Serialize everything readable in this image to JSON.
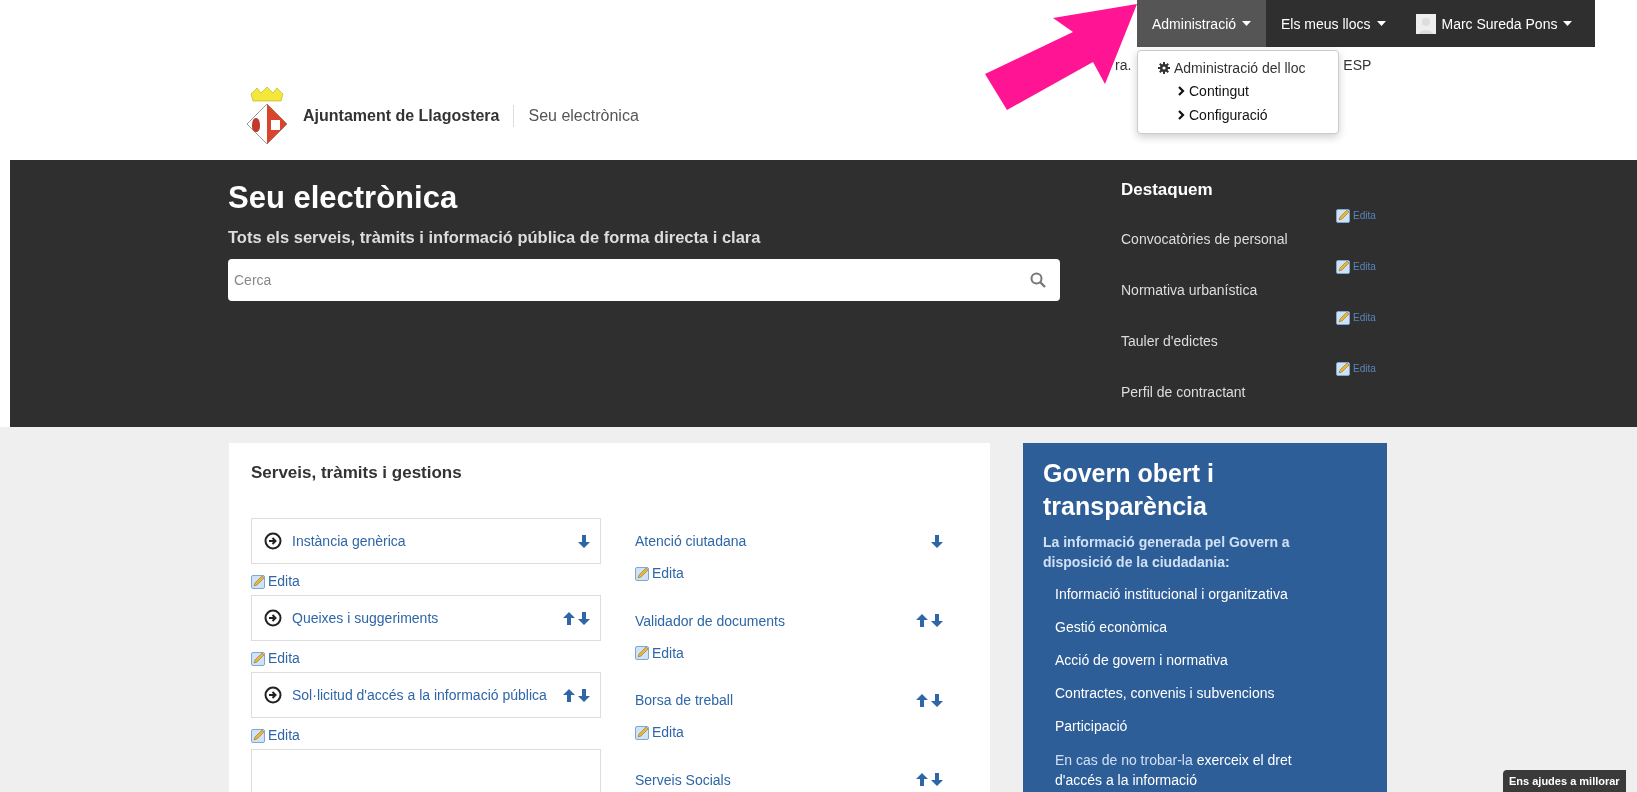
{
  "admin_bar": {
    "menus": [
      {
        "label": "Administració",
        "selected": true,
        "kind": "menu"
      },
      {
        "label": "Els meus llocs",
        "selected": false,
        "kind": "menu"
      },
      {
        "label": "Marc Sureda Pons",
        "selected": false,
        "kind": "user"
      }
    ]
  },
  "dropdown": {
    "title": "Administració del lloc",
    "items": [
      "Contingut",
      "Configuració"
    ]
  },
  "language_links": [
    "ra.",
    "ESP"
  ],
  "header": {
    "site_name": "Ajuntament de Llagostera",
    "section": "Seu electrònica"
  },
  "hero": {
    "title": "Seu electrònica",
    "subtitle": "Tots els serveis, tràmits i informació pública de forma directa i clara",
    "search": {
      "placeholder": "Cerca"
    }
  },
  "featured": {
    "title": "Destaquem",
    "items": [
      {
        "edit": "Edita",
        "label": "Convocatòries de personal"
      },
      {
        "edit": "Edita",
        "label": "Normativa urbanística"
      },
      {
        "edit": "Edita",
        "label": "Tauler d'edictes"
      },
      {
        "edit": "Edita",
        "label": "Perfil de contractant"
      }
    ]
  },
  "services": {
    "title": "Serveis, tràmits i gestions",
    "left": [
      {
        "label": "Instància genèrica",
        "up": false,
        "down": true,
        "edit": "Edita"
      },
      {
        "label": "Queixes i suggeriments",
        "up": true,
        "down": true,
        "edit": "Edita"
      },
      {
        "label": "Sol·licitud d'accés a la informació pública",
        "up": true,
        "down": true,
        "edit": "Edita"
      }
    ],
    "right": [
      {
        "label": "Atenció ciutadana",
        "up": false,
        "down": true,
        "edit": "Edita"
      },
      {
        "label": "Validador de documents",
        "up": true,
        "down": true,
        "edit": "Edita"
      },
      {
        "label": "Borsa de treball",
        "up": true,
        "down": true,
        "edit": "Edita"
      },
      {
        "label": "Serveis Socials",
        "up": true,
        "down": true
      }
    ]
  },
  "transparency": {
    "title": "Govern obert i transparència",
    "subtitle": "La informació generada pel Govern a disposició de la ciudadania:",
    "items": [
      "Informació institucional i organitzativa",
      "Gestió econòmica",
      "Acció de govern i normativa",
      "Contractes, convenis i subvencions",
      "Participació"
    ],
    "note": {
      "lead": "En cas de no trobar-la",
      "rest": "exerceix el dret d'accés a la informació"
    }
  },
  "feedback_tab": {
    "label": "Ens ajudes a millorar"
  }
}
